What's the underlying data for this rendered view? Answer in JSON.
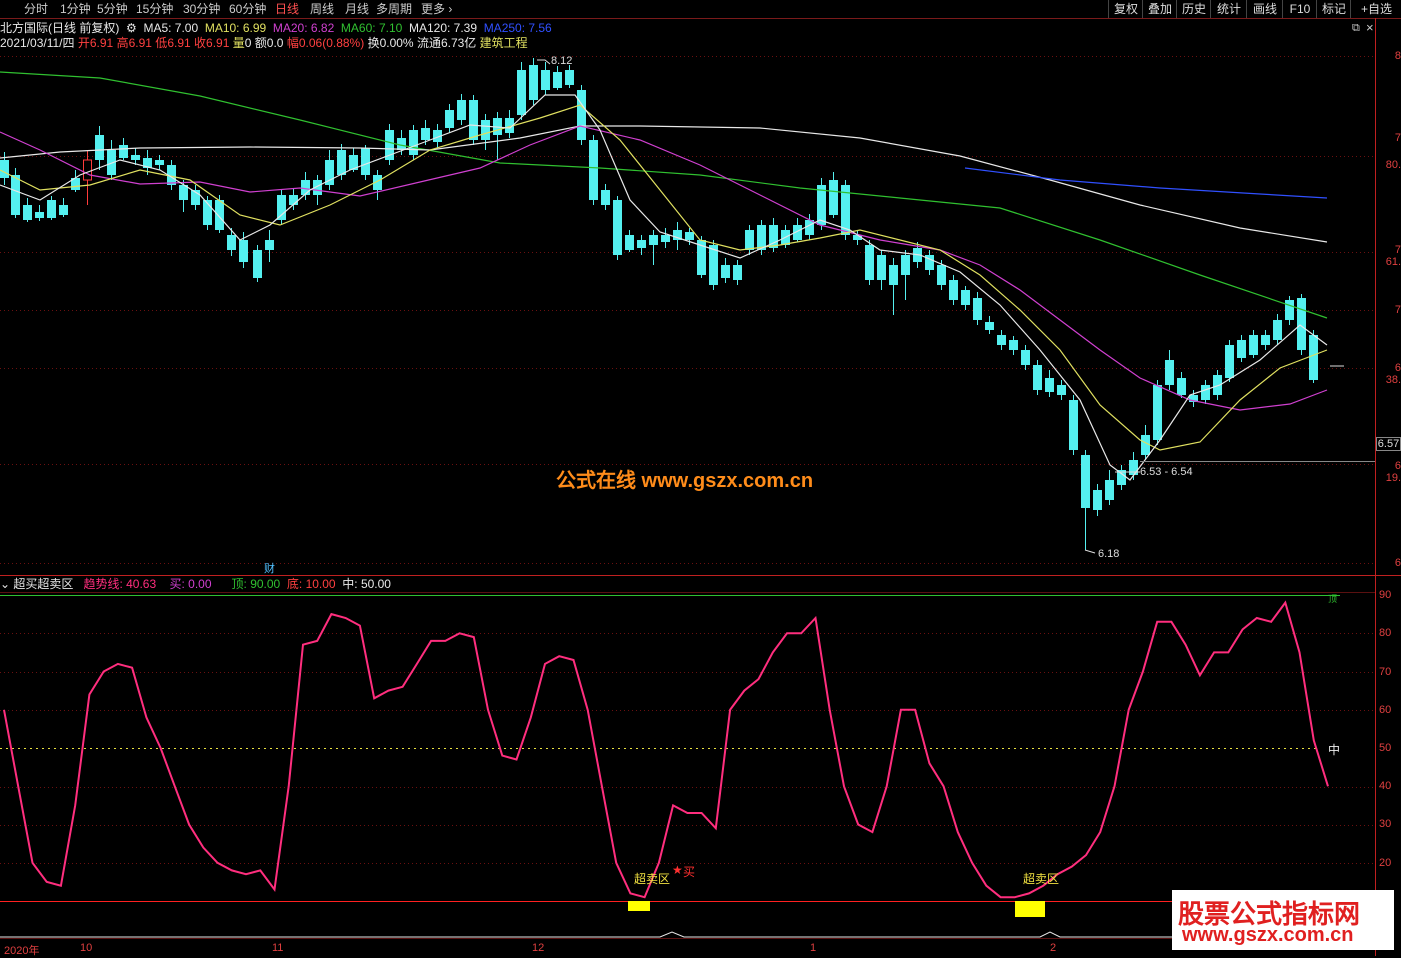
{
  "toolbar": {
    "tabs": [
      "分时",
      "1分钟",
      "5分钟",
      "15分钟",
      "30分钟",
      "60分钟",
      "日线",
      "周线",
      "月线",
      "多周期",
      "更多"
    ],
    "active_tab": "日线",
    "right_buttons": [
      "复权",
      "叠加",
      "历史",
      "统计",
      "画线",
      "F10",
      "标记",
      "+自选"
    ]
  },
  "info": {
    "stock": "北方国际(日线 前复权)",
    "ma5": "MA5: 7.00",
    "ma10": "MA10: 6.99",
    "ma20": "MA20: 6.82",
    "ma60": "MA60: 7.10",
    "ma120": "MA120: 7.39",
    "ma250": "MA250: 7.56",
    "date": "2021/03/11/四",
    "open_label": "开",
    "open": "6.91",
    "high_label": "高",
    "high": "6.91",
    "low_label": "低",
    "low": "6.91",
    "close_label": "收",
    "close": "6.91",
    "vol_label": "量",
    "vol": "0",
    "amt_label": "额",
    "amt": "0.0",
    "chg_label": "幅",
    "chg": "0.06(0.88%)",
    "turnover": "换0.00%",
    "float": "流通6.73亿",
    "industry": "建筑工程"
  },
  "annotations": {
    "high_price": "8.12",
    "low_price": "6.18",
    "range_label": "6.53 - 6.54",
    "price_tag": "6.57",
    "cai": "财",
    "watermark": "公式在线  www.gszx.com.cn",
    "watermark2_line1": "股票公式指标网",
    "watermark2_line2": "www.gszx.com.cn"
  },
  "price_axis": [
    "8",
    "7",
    "80.",
    "7",
    "61.",
    "7",
    "6",
    "38.",
    "6",
    "19.",
    "6"
  ],
  "indicator": {
    "name": "超买超卖区",
    "trend_label": "趋势线: 40.63",
    "buy_label": "买: 0.00",
    "top_label": "顶: 90.00",
    "bottom_label": "底: 10.00",
    "mid_label": "中: 50.00",
    "axis": [
      "90",
      "80",
      "70",
      "60",
      "50",
      "40",
      "30",
      "20"
    ],
    "zone_label": "超卖区",
    "buy_mark": "买",
    "mid_mark": "中",
    "top_mark": "顶"
  },
  "x_axis": [
    "2020年",
    "10",
    "11",
    "12",
    "1",
    "2"
  ],
  "chart_data": {
    "type": "candlestick",
    "title": "北方国际(日线 前复权)",
    "ma_series": [
      {
        "name": "MA5",
        "color": "#e8e8e8"
      },
      {
        "name": "MA10",
        "color": "#e0e060"
      },
      {
        "name": "MA20",
        "color": "#d040d0"
      },
      {
        "name": "MA60",
        "color": "#30c030"
      },
      {
        "name": "MA120",
        "color": "#e8e8e8"
      },
      {
        "name": "MA250",
        "color": "#3050ff"
      }
    ],
    "price_high": 8.12,
    "price_low": 6.18,
    "indicator_series": {
      "name": "趋势线",
      "color": "#ff2e7e",
      "ylim": [
        10,
        90
      ],
      "values": [
        60,
        40,
        20,
        15,
        14,
        35,
        64,
        70,
        72,
        71,
        58,
        50,
        40,
        30,
        24,
        20,
        18,
        17,
        18,
        13,
        40,
        77,
        78,
        85,
        84,
        82,
        63,
        65,
        66,
        72,
        78,
        78,
        80,
        79,
        60,
        48,
        47,
        58,
        72,
        74,
        73,
        60,
        40,
        20,
        12,
        11,
        20,
        35,
        33,
        33,
        29,
        60,
        65,
        68,
        75,
        80,
        80,
        84,
        60,
        40,
        30,
        28,
        40,
        60,
        60,
        46,
        40,
        28,
        20,
        14,
        11,
        11,
        12,
        14,
        17,
        19,
        22,
        28,
        40,
        60,
        70,
        83,
        83,
        77,
        69,
        75,
        75,
        81,
        84,
        83,
        88,
        75,
        52,
        40
      ]
    }
  }
}
